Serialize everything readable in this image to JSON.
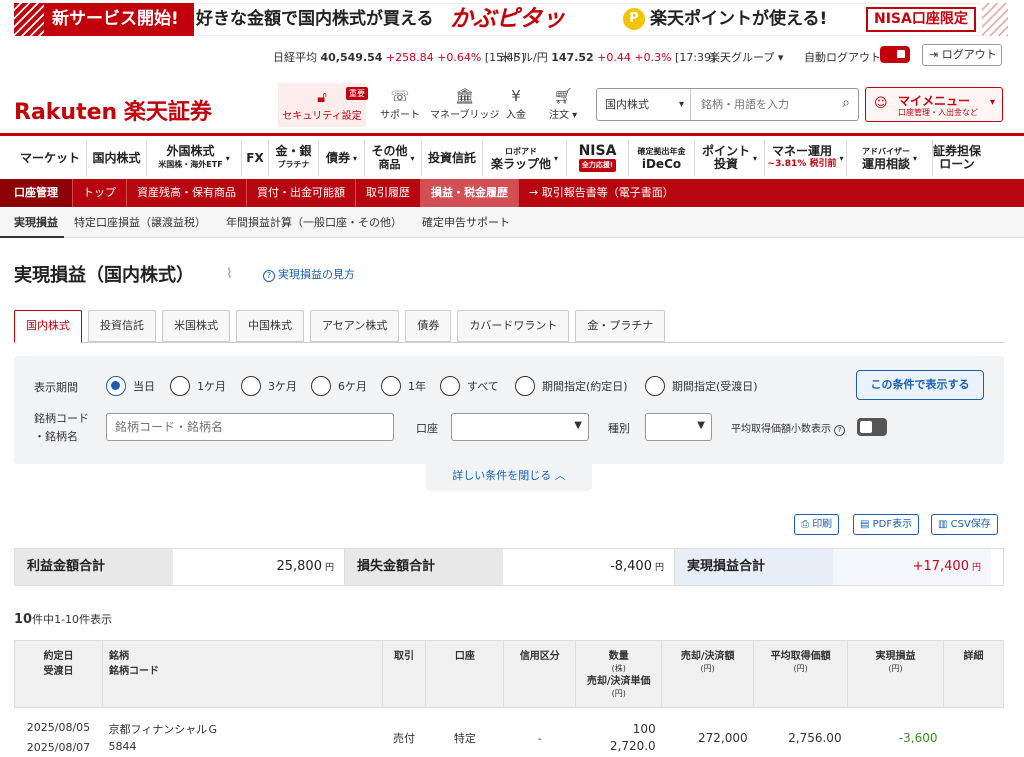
{
  "banner": {
    "new_service": "新サービス開始!",
    "tagline": "好きな金額で国内株式が買える",
    "brand": "かぶピタッ",
    "coin": "P",
    "points": "楽天ポイントが使える!",
    "nisa_badge": "NISA口座限定"
  },
  "ticker": {
    "nikkei_label": "日経平均",
    "nikkei_value": "40,549.54",
    "nikkei_change": "+258.84 +0.64%",
    "nikkei_time": "[15:45]",
    "usd_label": "米ドル/円",
    "usd_value": "147.52",
    "usd_change": "+0.44 +0.3%",
    "usd_time": "[17:39]",
    "group": "楽天グループ ▾",
    "auto_logout": "自動ログアウト",
    "logout": "ログアウト"
  },
  "header": {
    "logo_rakuten": "Rakuten",
    "logo_jp": "楽天証券",
    "icons": [
      {
        "label": "セキュリティ設定",
        "icon": "lock-icon",
        "badge": "重要"
      },
      {
        "label": "サポート",
        "icon": "support-icon"
      },
      {
        "label": "マネーブリッジ",
        "icon": "bank-icon"
      },
      {
        "label": "入金",
        "icon": "deposit-icon"
      },
      {
        "label": "注文 ▾",
        "icon": "cart-icon"
      }
    ],
    "search_select": "国内株式",
    "search_placeholder": "銘柄・用語を入力",
    "mymenu_title": "マイメニュー",
    "mymenu_sub": "口座管理・入出金など"
  },
  "main_nav": [
    {
      "label": "マーケット",
      "sub": ""
    },
    {
      "label": "国内株式",
      "sub": ""
    },
    {
      "label": "外国株式",
      "sub": "米国株・海外ETF"
    },
    {
      "label": "FX",
      "sub": ""
    },
    {
      "label": "金・銀",
      "sub": "プラチナ"
    },
    {
      "label": "債券",
      "sub": ""
    },
    {
      "label": "その他",
      "sub": "商品"
    },
    {
      "label": "投資信託",
      "sub": ""
    },
    {
      "label": "ロボアド",
      "sub": "楽ラップ他"
    },
    {
      "label": "NISA",
      "sub": "全力応援!"
    },
    {
      "label": "確定拠出年金",
      "sub": "iDeCo"
    },
    {
      "label": "ポイント",
      "sub": "投資"
    },
    {
      "label": "マネー運用",
      "sub": "~3.81% 税引前"
    },
    {
      "label": "アドバイザー",
      "sub": "運用相談"
    },
    {
      "label": "証券担保",
      "sub": "ローン"
    }
  ],
  "sub_nav": [
    "口座管理",
    "トップ",
    "資産残高・保有商品",
    "買付・出金可能額",
    "取引履歴",
    "損益・税金履歴",
    "→ 取引報告書等（電子書面）"
  ],
  "crumb_tabs": [
    "実現損益",
    "特定口座損益（譲渡益税）",
    "年間損益計算（一般口座・その他）",
    "確定申告サポート"
  ],
  "page": {
    "title": "実現損益（国内株式）",
    "howto": "実現損益の見方"
  },
  "market_tabs": [
    "国内株式",
    "投資信託",
    "米国株式",
    "中国株式",
    "アセアン株式",
    "債券",
    "カバードワラント",
    "金・プラチナ"
  ],
  "filter": {
    "period_label": "表示期間",
    "periods": [
      "当日",
      "1ケ月",
      "3ケ月",
      "6ケ月",
      "1年",
      "すべて",
      "期間指定(約定日)",
      "期間指定(受渡日)"
    ],
    "selected_period": "当日",
    "submit": "この条件で表示する",
    "code_label_1": "銘柄コード",
    "code_label_2": "・銘柄名",
    "code_placeholder": "銘柄コード・銘柄名",
    "account_label": "口座",
    "type_label": "種別",
    "avg_label": "平均取得価額小数表示",
    "close": "詳しい条件を閉じる ︿"
  },
  "actions": {
    "print": "印刷",
    "pdf": "PDF表示",
    "csv": "CSV保存"
  },
  "summary": {
    "profit_label": "利益金額合計",
    "profit_value": "25,800",
    "loss_label": "損失金額合計",
    "loss_value": "-8,400",
    "realized_label": "実現損益合計",
    "realized_value": "+17,400",
    "unit": "円"
  },
  "result_count": {
    "total": "10",
    "rest": "件中1-10件表示"
  },
  "table": {
    "headers": {
      "date1": "約定日",
      "date2": "受渡日",
      "name1": "銘柄",
      "name2": "銘柄コード",
      "trade": "取引",
      "account": "口座",
      "credit": "信用区分",
      "qty": "数量",
      "qty_unit": "(株)",
      "qty2": "売却/決済単価",
      "qty2_unit": "(円)",
      "amount": "売却/決済額",
      "amount_unit": "(円)",
      "avg": "平均取得価額",
      "avg_unit": "(円)",
      "pl": "実現損益",
      "pl_unit": "(円)",
      "detail": "詳細"
    },
    "rows": [
      {
        "trade_date": "2025/08/05",
        "settle_date": "2025/08/07",
        "name": "京都フィナンシャルＧ",
        "code": "5844",
        "trade": "売付",
        "account": "特定",
        "credit": "-",
        "qty": "100",
        "price": "2,720.0",
        "amount": "272,000",
        "avg": "2,756.00",
        "pl": "-3,600"
      }
    ]
  },
  "colors": {
    "brand_red": "#c2000b",
    "link_blue": "#1a5fb4",
    "profit": "#d0021b",
    "loss": "#3a8a2a"
  }
}
